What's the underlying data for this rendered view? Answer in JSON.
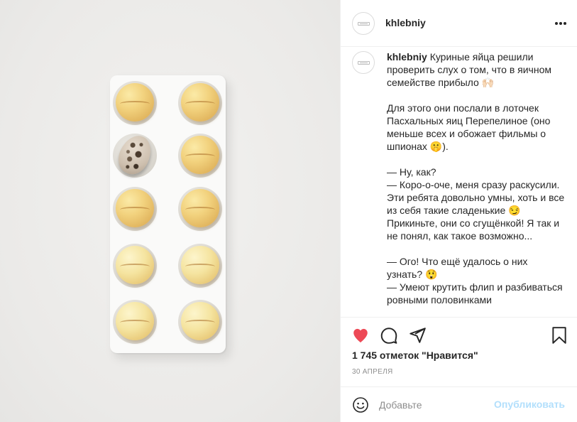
{
  "post": {
    "username": "khlebniy",
    "caption_author": "khlebniy",
    "caption_paragraphs": [
      "Куриные яйца решили проверить слух о том, что в яичном семействе прибыло 🙌🏻",
      "Для этого они послали в лоточек Пасхальных яиц Перепелиное (оно меньше всех и обожает фильмы о шпионах 🤫).",
      "— Ну, как?\n— Коро-о-оче, меня сразу раскусили. Эти ребята довольно умны, хоть и все из себя такие сладенькие 😏\nПрикиньте, они со сгущёнкой! Я так и не понял, как такое возможно...",
      "— Ого! Что ещё удалось о них узнать? 😲\n— Умеют крутить флип и разбиваться ровными половинками"
    ],
    "likes_text": "1 745 отметок \"Нравится\"",
    "date": "30 апреля"
  },
  "comment": {
    "placeholder": "Добавьте",
    "post_label": "Опубликовать"
  },
  "icons": {
    "like": "heart-filled-icon",
    "comment": "speech-bubble-icon",
    "share": "paper-plane-icon",
    "save": "bookmark-icon",
    "emoji": "smile-icon",
    "more": "ellipsis-icon"
  },
  "colors": {
    "like_red": "#ed4956",
    "post_button_disabled": "#b2dffc",
    "text": "#262626",
    "muted": "#8e8e8e"
  }
}
